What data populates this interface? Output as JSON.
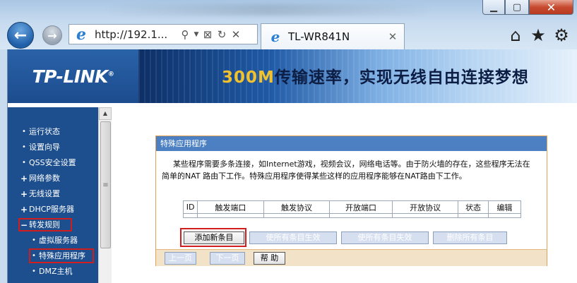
{
  "browser": {
    "url": "http://192.1...",
    "tab_title": "TL-WR841N",
    "window_buttons": {
      "minimize": "▁",
      "maximize": "▢",
      "close": "✕"
    },
    "icons": [
      "back-arrow-icon",
      "forward-arrow-icon",
      "ie-logo-icon",
      "search-icon",
      "dropdown-icon",
      "compat-view-icon",
      "refresh-icon",
      "stop-icon",
      "home-icon",
      "favorites-star-icon",
      "gear-icon"
    ]
  },
  "banner": {
    "logo": "TP-LINK",
    "logo_mark": "®",
    "slogan_highlight": "300M",
    "slogan_rest": "传输速率，实现无线自由连接梦想"
  },
  "sidebar": {
    "items": [
      {
        "label": "运行状态",
        "bullet": "•"
      },
      {
        "label": "设置向导",
        "bullet": "•"
      },
      {
        "label": "QSS安全设置",
        "bullet": "•"
      },
      {
        "label": "网络参数",
        "bullet": "+"
      },
      {
        "label": "无线设置",
        "bullet": "+"
      },
      {
        "label": "DHCP服务器",
        "bullet": "+"
      },
      {
        "label": "转发规则",
        "bullet": "−"
      },
      {
        "label": "虚拟服务器",
        "bullet": "•"
      },
      {
        "label": "特殊应用程序",
        "bullet": "•"
      },
      {
        "label": "DMZ主机",
        "bullet": "•"
      }
    ]
  },
  "panel": {
    "title": "特殊应用程序",
    "description": "某些程序需要多条连接，如Internet游戏，视频会议，网络电话等。由于防火墙的存在，这些程序无法在简单的NAT 路由下工作。特殊应用程序使得某些这样的应用程序能够在NAT路由下工作。",
    "table_headers": [
      "ID",
      "触发端口",
      "触发协议",
      "开放端口",
      "开放协议",
      "状态",
      "编辑"
    ],
    "buttons": {
      "add": "添加新条目",
      "enable_all": "使所有条目生效",
      "disable_all": "使所有条目失效",
      "delete_all": "删除所有条目"
    },
    "footer": {
      "prev": "上一页",
      "next": "下一页",
      "help": "帮 助"
    }
  }
}
